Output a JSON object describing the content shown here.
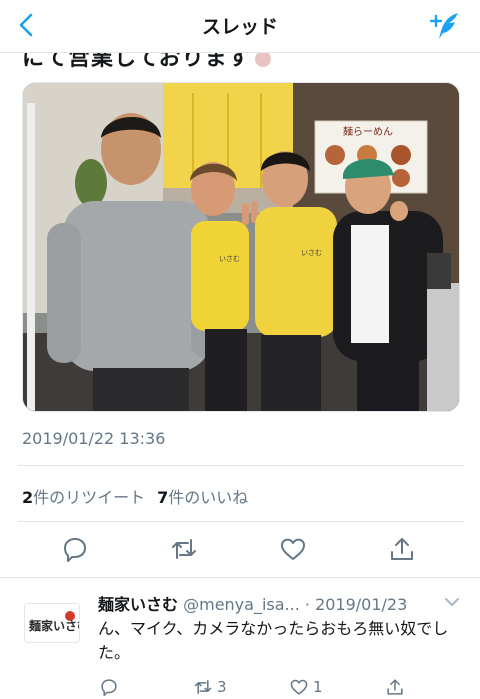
{
  "header": {
    "title": "スレッド",
    "back_icon": "back-arrow-icon",
    "compose_icon": "compose-tweet-icon",
    "accent": "#1da1f2"
  },
  "tweet": {
    "partial_text": "にて営業しております",
    "photo": {
      "sign_text": "麺らーめん",
      "shirt_text": "いさむ"
    },
    "timestamp": "2019/01/22 13:36",
    "retweet_count": "2",
    "retweet_label": "件のリツイート",
    "like_count": "7",
    "like_label": "件のいいね",
    "actions": [
      "reply-icon",
      "retweet-icon",
      "like-icon",
      "share-icon"
    ]
  },
  "reply": {
    "logo_text": "麺家いさむ",
    "name": "麺家いさむ",
    "handle": "@menya_isa...",
    "date": "· 2019/01/23",
    "text": "ん、マイク、カメラなかったらおもろ無い奴でした。",
    "retweet_count": "3",
    "like_count": "1"
  }
}
